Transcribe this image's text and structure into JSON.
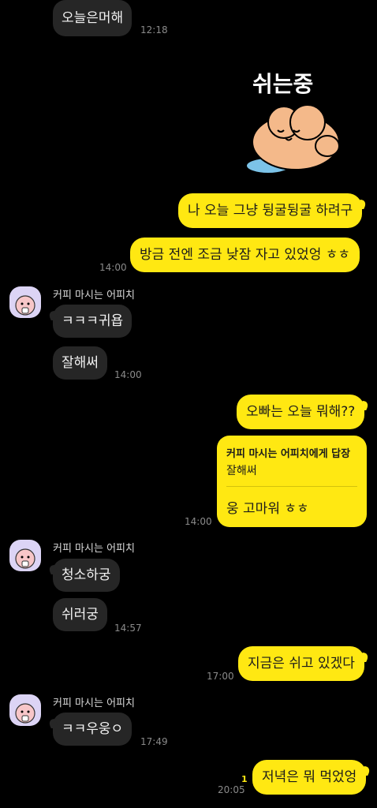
{
  "messages": {
    "m1_text": "오늘은머해",
    "m1_time": "12:18",
    "sticker_text": "쉬는중",
    "m2_text": "나 오늘 그냥 뒹굴뒹굴 하려구",
    "m3_text": "방금 전엔 조금 낮잠 자고 있었엉 ㅎㅎ",
    "m3_time": "14:00",
    "sender_name": "커피 마시는 어피치",
    "m4_text": "ㅋㅋㅋ귀욥",
    "m5_text": "잘해써",
    "m5_time": "14:00",
    "m6_text": "오빠는 오늘 뭐해??",
    "reply_title": "커피 마시는 어피치에게 답장",
    "reply_quote": "잘해써",
    "reply_text": "웅 고마워 ㅎㅎ",
    "m7_time": "14:00",
    "m8_text": "청소하궁",
    "m9_text": "쉬러궁",
    "m9_time": "14:57",
    "m10_text": "지금은 쉬고 있겠다",
    "m10_time": "17:00",
    "m11_text": "ㅋㅋ우웅ㅇ",
    "m11_time": "17:49",
    "m12_text": "저녁은 뭐 먹었엉",
    "m12_unread": "1",
    "m12_time": "20:05"
  }
}
